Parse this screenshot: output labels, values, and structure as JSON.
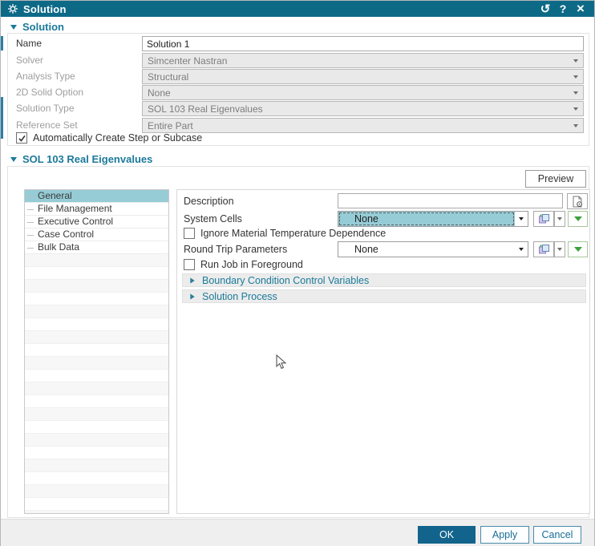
{
  "colors": {
    "titlebar": "#0d6a87",
    "accent": "#1b7a99",
    "selection": "#96ccd6",
    "ok_fill": "#12648c",
    "button_border": "#4a8cab",
    "green_arrow": "#3ba33b"
  },
  "titlebar": {
    "title": "Solution",
    "icons": {
      "reset": "↺",
      "help": "?",
      "close": "×"
    }
  },
  "solution": {
    "header": "Solution",
    "fields": [
      {
        "label": "Name",
        "value": "Solution 1"
      },
      {
        "label": "Solver",
        "value": "Simcenter Nastran"
      },
      {
        "label": "Analysis Type",
        "value": "Structural"
      },
      {
        "label": "2D Solid Option",
        "value": "None"
      },
      {
        "label": "Solution Type",
        "value": "SOL 103 Real Eigenvalues"
      },
      {
        "label": "Reference Set",
        "value": "Entire Part"
      }
    ],
    "auto_subcase": {
      "label": "Automatically Create Step or Subcase",
      "checked": true
    }
  },
  "sol103": {
    "header": "SOL 103 Real Eigenvalues",
    "preview_label": "Preview",
    "nav_items": [
      "General",
      "File Management",
      "Executive Control",
      "Case Control",
      "Bulk Data"
    ],
    "selected_index": 0,
    "general": {
      "description_label": "Description",
      "description_value": "",
      "system_cells": {
        "label": "System Cells",
        "value": "None"
      },
      "ignore_material": {
        "label": "Ignore Material Temperature Dependence",
        "checked": false
      },
      "round_trip": {
        "label": "Round Trip Parameters",
        "value": "None"
      },
      "run_job": {
        "label": "Run Job in Foreground",
        "checked": false
      },
      "expanders": [
        {
          "label": "Boundary Condition Control Variables"
        },
        {
          "label": "Solution Process"
        }
      ]
    }
  },
  "footer": {
    "ok": "OK",
    "apply": "Apply",
    "cancel": "Cancel"
  }
}
